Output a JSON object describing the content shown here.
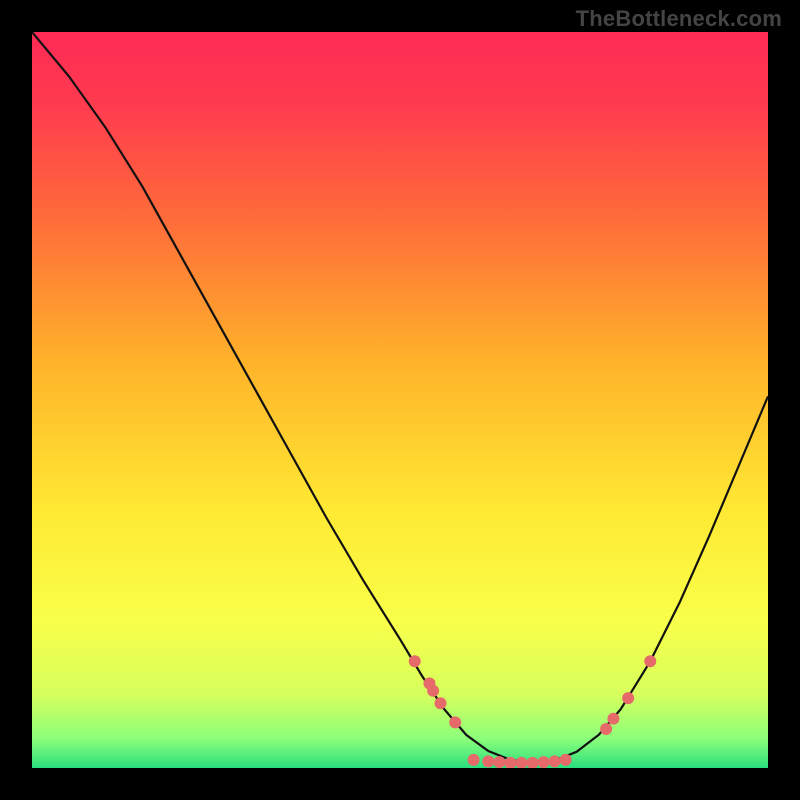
{
  "watermark": "TheBottleneck.com",
  "chart_data": {
    "type": "line",
    "title": "",
    "xlabel": "",
    "ylabel": "",
    "xlim": [
      0,
      100
    ],
    "ylim": [
      0,
      100
    ],
    "gradient_stops": [
      {
        "offset": 0.0,
        "color": "#ff2a55"
      },
      {
        "offset": 0.1,
        "color": "#ff3b4f"
      },
      {
        "offset": 0.25,
        "color": "#ff6a3a"
      },
      {
        "offset": 0.45,
        "color": "#ffb32a"
      },
      {
        "offset": 0.65,
        "color": "#ffe933"
      },
      {
        "offset": 0.8,
        "color": "#f9ff4a"
      },
      {
        "offset": 0.9,
        "color": "#d6ff5d"
      },
      {
        "offset": 0.96,
        "color": "#8cff7a"
      },
      {
        "offset": 1.0,
        "color": "#2bde7e"
      }
    ],
    "curve": [
      {
        "x": 0.0,
        "y": 100.0
      },
      {
        "x": 5.0,
        "y": 94.0
      },
      {
        "x": 10.0,
        "y": 87.0
      },
      {
        "x": 15.0,
        "y": 79.0
      },
      {
        "x": 20.0,
        "y": 70.0
      },
      {
        "x": 25.0,
        "y": 61.0
      },
      {
        "x": 30.0,
        "y": 52.0
      },
      {
        "x": 35.0,
        "y": 43.0
      },
      {
        "x": 40.0,
        "y": 34.0
      },
      {
        "x": 45.0,
        "y": 25.5
      },
      {
        "x": 50.0,
        "y": 17.5
      },
      {
        "x": 53.0,
        "y": 12.5
      },
      {
        "x": 56.0,
        "y": 8.0
      },
      {
        "x": 59.0,
        "y": 4.5
      },
      {
        "x": 62.0,
        "y": 2.3
      },
      {
        "x": 65.0,
        "y": 1.1
      },
      {
        "x": 68.0,
        "y": 0.7
      },
      {
        "x": 71.0,
        "y": 1.0
      },
      {
        "x": 74.0,
        "y": 2.2
      },
      {
        "x": 77.0,
        "y": 4.5
      },
      {
        "x": 80.0,
        "y": 8.0
      },
      {
        "x": 84.0,
        "y": 14.5
      },
      {
        "x": 88.0,
        "y": 22.5
      },
      {
        "x": 92.0,
        "y": 31.5
      },
      {
        "x": 96.0,
        "y": 41.0
      },
      {
        "x": 100.0,
        "y": 50.5
      }
    ],
    "markers": [
      {
        "x": 52.0,
        "y": 14.5
      },
      {
        "x": 54.0,
        "y": 11.5
      },
      {
        "x": 54.5,
        "y": 10.5
      },
      {
        "x": 55.5,
        "y": 8.8
      },
      {
        "x": 57.5,
        "y": 6.2
      },
      {
        "x": 60.0,
        "y": 1.1
      },
      {
        "x": 62.0,
        "y": 0.9
      },
      {
        "x": 63.5,
        "y": 0.8
      },
      {
        "x": 65.0,
        "y": 0.7
      },
      {
        "x": 66.5,
        "y": 0.7
      },
      {
        "x": 68.0,
        "y": 0.7
      },
      {
        "x": 69.5,
        "y": 0.8
      },
      {
        "x": 71.0,
        "y": 0.9
      },
      {
        "x": 72.5,
        "y": 1.1
      },
      {
        "x": 78.0,
        "y": 5.3
      },
      {
        "x": 79.0,
        "y": 6.7
      },
      {
        "x": 81.0,
        "y": 9.5
      },
      {
        "x": 84.0,
        "y": 14.5
      }
    ],
    "marker_color": "#e76a6a",
    "curve_color": "#111111"
  }
}
